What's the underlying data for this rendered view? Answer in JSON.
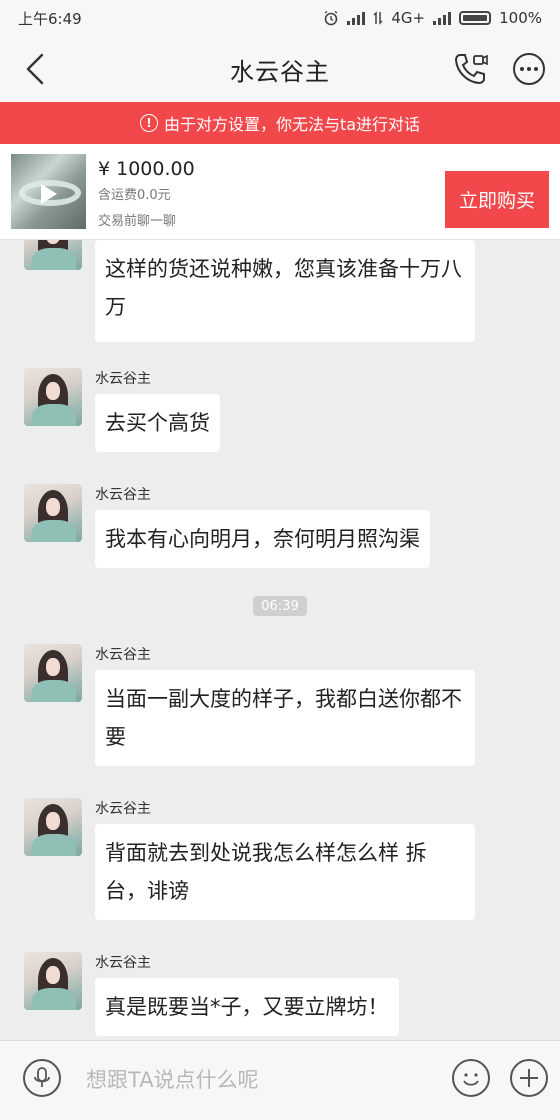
{
  "status_bar": {
    "time": "上午6:49",
    "network": "4G+",
    "battery": "100%",
    "icons": [
      "alarm-icon",
      "signal-icon",
      "network-arrows-icon",
      "signal-icon",
      "battery-icon"
    ]
  },
  "header": {
    "title": "水云谷主",
    "icons": [
      "back-arrow-icon",
      "phone-video-icon",
      "more-dots-icon"
    ]
  },
  "warning": {
    "text": "由于对方设置，你无法与ta进行对话",
    "icon": "exclamation-circle-icon"
  },
  "product": {
    "price": "¥ 1000.00",
    "shipping": "含运费0.0元",
    "hint": "交易前聊一聊",
    "buy_label": "立即购买",
    "icon": "play-icon"
  },
  "timestamp": "06:39",
  "messages": [
    {
      "sender": "",
      "text": "这样的货还说种嫩，您真该准备十万八万"
    },
    {
      "sender": "水云谷主",
      "text": "去买个高货"
    },
    {
      "sender": "水云谷主",
      "text": "我本有心向明月，奈何明月照沟渠"
    },
    {
      "sender": "水云谷主",
      "text": "当面一副大度的样子，我都白送你都不要"
    },
    {
      "sender": "水云谷主",
      "text": "背面就去到处说我怎么样怎么样 拆台，诽谤"
    },
    {
      "sender": "水云谷主",
      "text": "真是既要当*子，又要立牌坊！"
    }
  ],
  "input": {
    "placeholder": "想跟TA说点什么呢",
    "value": "",
    "icons": [
      "microphone-icon",
      "emoji-icon",
      "plus-icon"
    ]
  },
  "colors": {
    "accent_red": "#f2484b",
    "background": "#ededed",
    "bubble": "#ffffff"
  }
}
